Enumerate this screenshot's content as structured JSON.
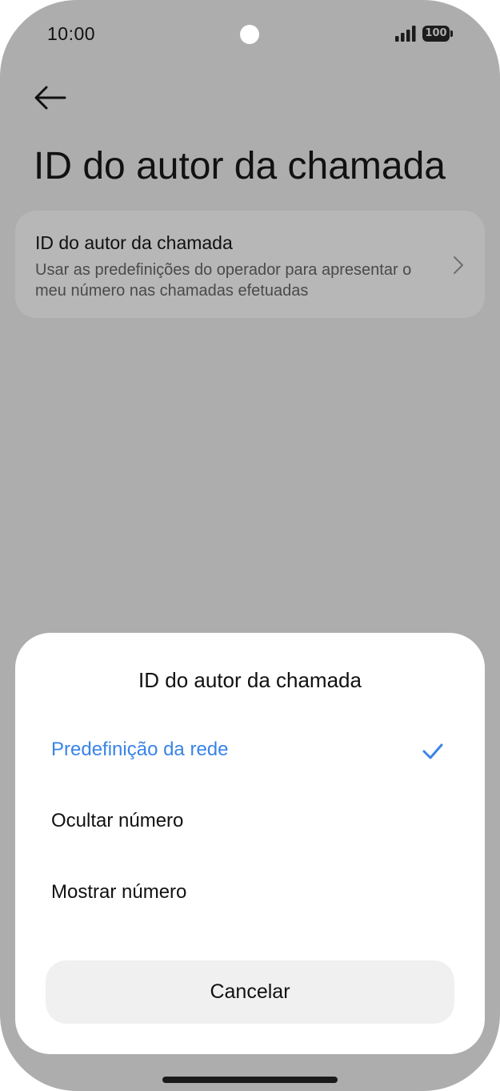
{
  "status_bar": {
    "time": "10:00",
    "battery_level": "100",
    "icons": [
      "camera-cutout",
      "signal-icon",
      "battery-icon"
    ]
  },
  "header": {
    "back_icon": "arrow-left-icon",
    "title": "ID do autor da chamada"
  },
  "setting": {
    "title": "ID do autor da chamada",
    "description": "Usar as predefinições do operador para apresentar o meu número nas chamadas efetuadas",
    "chevron_icon": "chevron-right-icon"
  },
  "sheet": {
    "title": "ID do autor da chamada",
    "options": [
      {
        "label": "Predefinição da rede",
        "selected": true
      },
      {
        "label": "Ocultar número",
        "selected": false
      },
      {
        "label": "Mostrar número",
        "selected": false
      }
    ],
    "check_icon": "check-icon",
    "cancel_label": "Cancelar"
  },
  "colors": {
    "scrim_background": "#adadad",
    "card_background": "#b7b7b7",
    "accent": "#3a84e8",
    "sheet_background": "#ffffff",
    "cancel_background": "#f0f0f0"
  }
}
